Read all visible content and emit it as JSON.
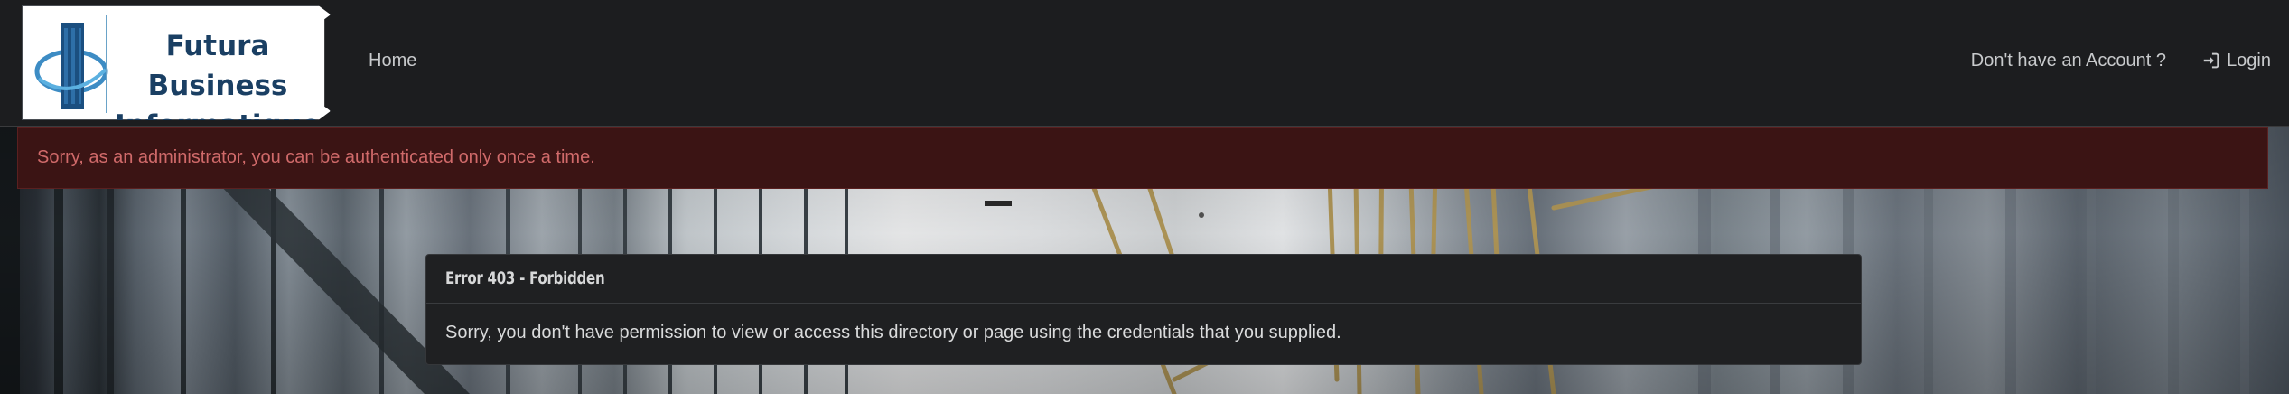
{
  "brand": {
    "name_line1": "Futura Business",
    "name_line2": "Informatique",
    "logo_icon": "building-tower-icon"
  },
  "navbar": {
    "home_label": "Home",
    "account_label": "Don't have an Account ?",
    "login_label": "Login",
    "login_icon": "sign-in-icon"
  },
  "alert": {
    "message": "Sorry, as an administrator, you can be authenticated only once a time."
  },
  "error_card": {
    "title": "Error 403 - Forbidden",
    "message": "Sorry, you don't have permission to view or access this directory or page using the credentials that you supplied."
  },
  "colors": {
    "navbar_bg": "#1c1d1f",
    "alert_bg": "#3b1414",
    "alert_text": "#d06a6a",
    "card_bg": "#1f2022",
    "brand_text": "#1a3f63"
  }
}
